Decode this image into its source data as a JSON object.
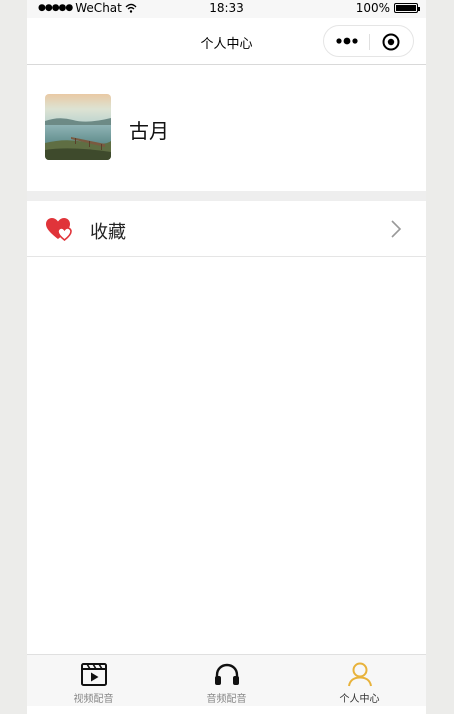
{
  "status_bar": {
    "carrier": "WeChat",
    "time": "18:33",
    "battery": "100%"
  },
  "nav": {
    "title": "个人中心"
  },
  "profile": {
    "username": "古月"
  },
  "menu": {
    "favorites_label": "收藏"
  },
  "tab_bar": {
    "tabs": [
      {
        "label": "视频配音",
        "icon": "video-icon",
        "active": false
      },
      {
        "label": "音频配音",
        "icon": "headphones-icon",
        "active": false
      },
      {
        "label": "个人中心",
        "icon": "user-icon",
        "active": true
      }
    ]
  },
  "colors": {
    "accent": "#e8b23a",
    "heart": "#e0343a"
  }
}
